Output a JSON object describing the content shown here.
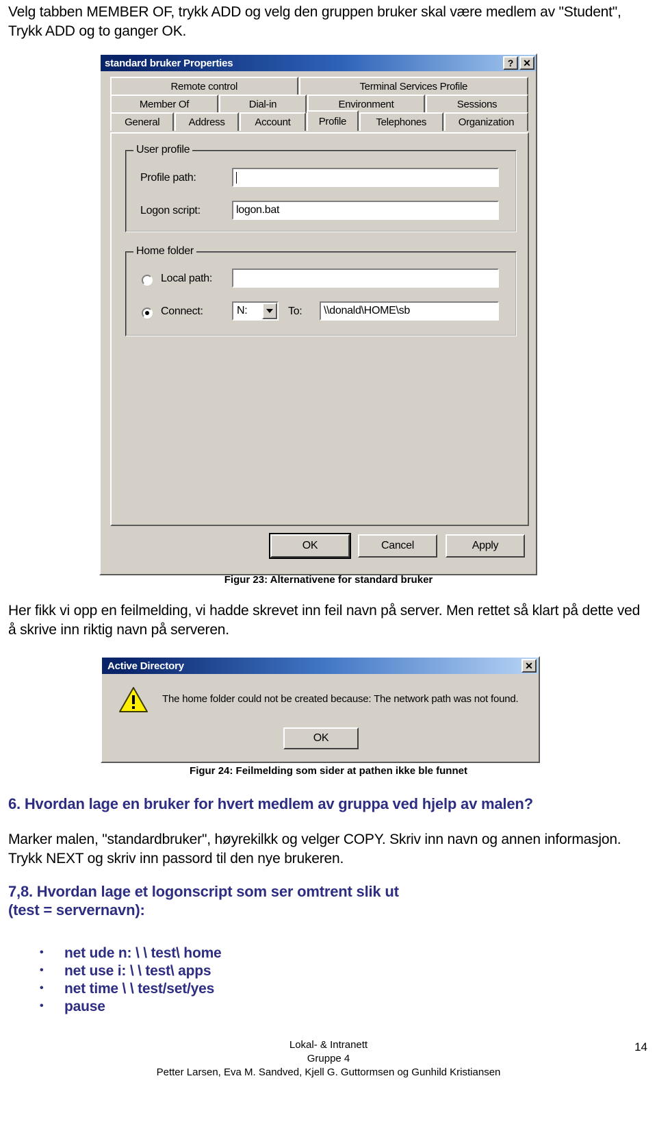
{
  "intro": {
    "text": "Velg tabben MEMBER OF, trykk ADD og velg den gruppen bruker skal være medlem av \"Student\", Trykk ADD og to ganger OK."
  },
  "properties_dialog": {
    "title": "standard bruker Properties",
    "help_button": "?",
    "close_button": "✕",
    "tab_rows": [
      [
        {
          "label": "Remote control",
          "active": false
        },
        {
          "label": "Terminal Services Profile",
          "active": false
        }
      ],
      [
        {
          "label": "Member Of",
          "active": false
        },
        {
          "label": "Dial-in",
          "active": false
        },
        {
          "label": "Environment",
          "active": false
        },
        {
          "label": "Sessions",
          "active": false
        }
      ],
      [
        {
          "label": "General",
          "active": false
        },
        {
          "label": "Address",
          "active": false
        },
        {
          "label": "Account",
          "active": false
        },
        {
          "label": "Profile",
          "active": true
        },
        {
          "label": "Telephones",
          "active": false
        },
        {
          "label": "Organization",
          "active": false
        }
      ]
    ],
    "user_profile_group": {
      "title": "User profile",
      "profile_path_label": "Profile path:",
      "profile_path_value": "",
      "logon_script_label": "Logon script:",
      "logon_script_value": "logon.bat"
    },
    "home_folder_group": {
      "title": "Home folder",
      "local_path_label": "Local path:",
      "local_path_value": "",
      "local_path_selected": false,
      "connect_label": "Connect:",
      "connect_selected": true,
      "drive_value": "N:",
      "to_label": "To:",
      "to_value": "\\\\donald\\HOME\\sb"
    },
    "buttons": {
      "ok": "OK",
      "cancel": "Cancel",
      "apply": "Apply"
    }
  },
  "figure23_caption": "Figur 23: Alternativene for standard bruker",
  "paragraph1": "Her fikk vi opp en feilmelding, vi hadde skrevet inn feil navn på server. Men rettet så klart på dette ved å skrive inn riktig navn på serveren.",
  "active_directory_dialog": {
    "title": "Active Directory",
    "close_button": "✕",
    "icon": "warning-triangle-icon",
    "message": "The home folder could not be created because: The network path was not found.",
    "ok_button": "OK"
  },
  "figure24_caption": "Figur 24: Feilmelding som sider at pathen ikke ble funnet",
  "heading6": "6. Hvordan lage en bruker for hvert medlem av gruppa ved hjelp av malen?",
  "paragraph2": "Marker malen, \"standardbruker\", høyrekilkk og velger COPY. Skriv inn navn og annen informasjon. Trykk NEXT og skriv inn passord til den nye brukeren.",
  "heading78_line1": "7,8. Hvordan lage et logonscript som ser omtrent slik ut",
  "heading78_line2": "(test = servernavn):",
  "bullets": [
    "net ude n: \\ \\ test\\ home",
    "net use i: \\ \\ test\\ apps",
    "net time \\ \\ test/set/yes",
    "pause"
  ],
  "footer": {
    "line1": "Lokal- & Intranett",
    "line2": "Gruppe 4",
    "line3": "Petter Larsen, Eva M. Sandved, Kjell G. Guttormsen og Gunhild Kristiansen",
    "page_number": "14"
  },
  "colors": {
    "heading": "#2d2d82",
    "dialog_face": "#d4d0c8",
    "title_bar_start": "#0a246a",
    "warning_yellow": "#ffef00"
  }
}
